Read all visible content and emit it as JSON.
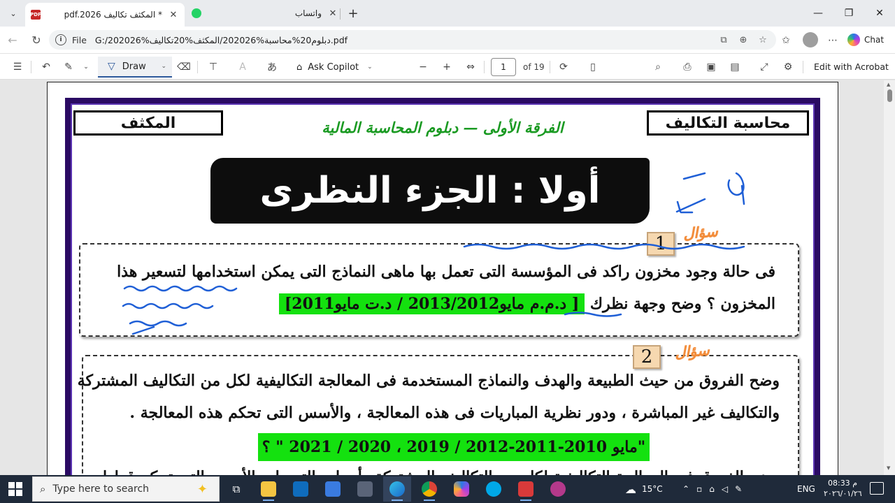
{
  "browser": {
    "tabs": [
      {
        "title": "pdf.2026 المكثف تكاليف *",
        "icon": "pdf-icon",
        "active": true
      },
      {
        "title": "واتساب",
        "icon": "whatsapp-icon",
        "active": false
      }
    ],
    "address": {
      "scheme": "File",
      "url": "G:/202026%دبلوم20%محاسبة%202026/المكثف%20تكاليف.pdf"
    },
    "chat_label": "Chat"
  },
  "pdf_toolbar": {
    "draw_label": "Draw",
    "ask_copilot_label": "Ask Copilot",
    "page_current": "1",
    "page_total": "of 19",
    "edit_acrobat_label": "Edit with Acrobat"
  },
  "document": {
    "header_right": "محاسبة التكاليف",
    "header_left": "المكثف",
    "subtitle": "الفرقة الأولى — دبلوم المحاسبة المالية",
    "banner": "أولا : الجزء النظرى",
    "tag_label": "سؤال",
    "questions": [
      {
        "number": "1",
        "line1": "فى حالة وجود مخزون راكد فى المؤسسة التى تعمل بها ماهى النماذج التى يمكن استخدامها لتسعير هذا",
        "line2_text": "المخزون ؟ وضح وجهة نظرك",
        "ref": "[ د.م.م مايو2013/2012 / د.ت مايو2011]"
      },
      {
        "number": "2",
        "line1": "وضح الفروق من حيث الطبيعة والهدف والنماذج المستخدمة فى المعالجة التكاليفية لكل من التكاليف المشتركة",
        "line2": "والتكاليف غير المباشرة ، ودور نظرية المباريات فى هذه المعالجة ، والأسس التى تحكم هذه المعالجة .",
        "ref": "\"مايو 2010-2011-2012 / 2019 ، 2020 / 2021 \" ؟",
        "line3_partial": "وضح الفروق فى المعالجة التكاليفية لكل من التكاليف المشتركة وأسباب التحويل والأسس التى تحكم قرارات"
      }
    ]
  },
  "taskbar": {
    "search_placeholder": "Type here to search",
    "weather": "15°C",
    "language": "ENG",
    "time": "08:33 م",
    "date": "٢٠٢٦/٠١/٢٦",
    "apps": [
      "task-view",
      "file-explorer",
      "outlook",
      "store",
      "calculator",
      "edge",
      "chrome",
      "copilot",
      "skype",
      "zoom",
      "app"
    ]
  },
  "colors": {
    "frame_purple": "#2a0a63",
    "highlight_green": "#14e10f",
    "subtitle_green": "#1a9a22",
    "tag_orange": "#f28c3a",
    "ink_blue": "#1f5fd6"
  }
}
